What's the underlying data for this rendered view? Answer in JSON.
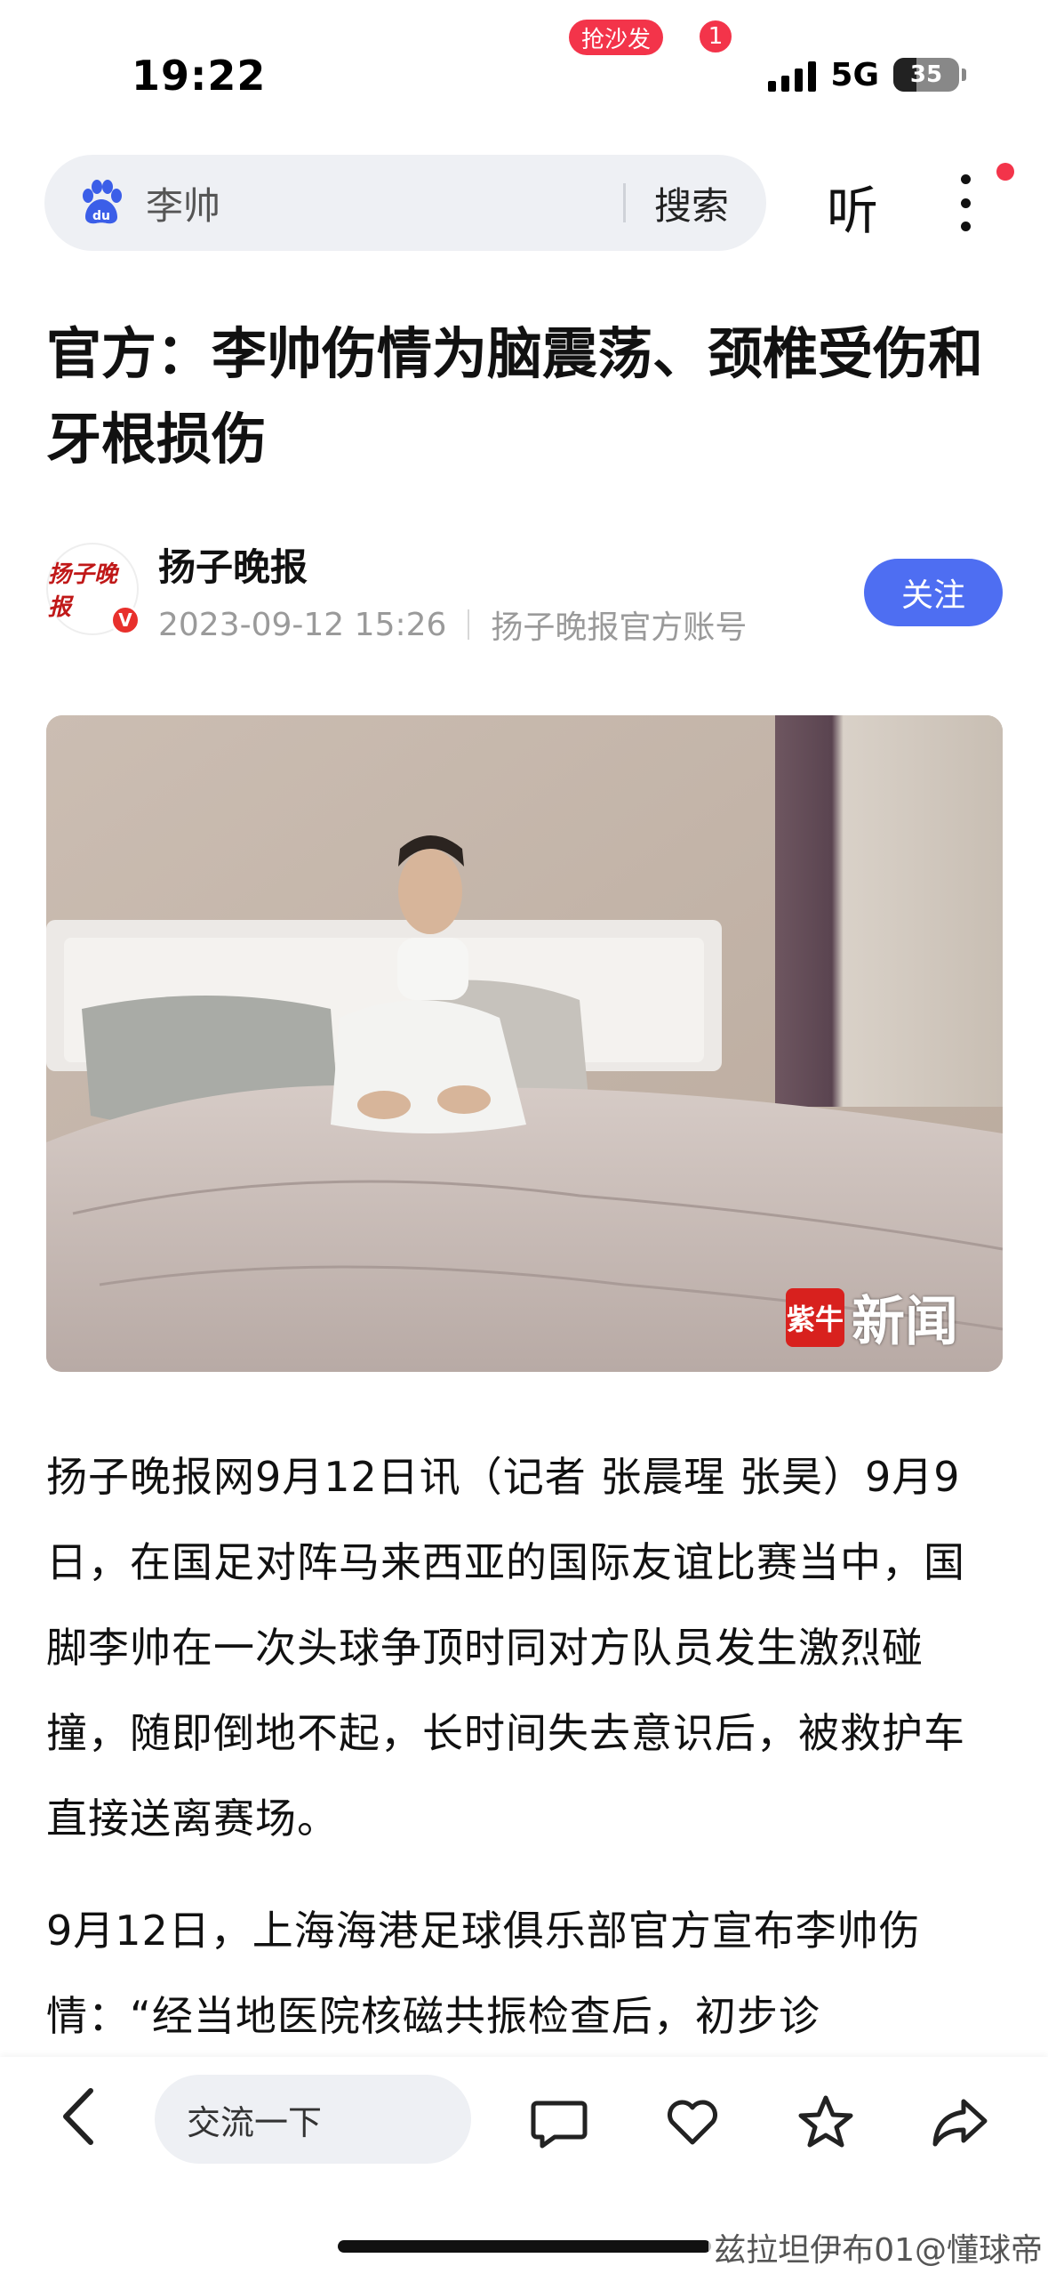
{
  "status_bar": {
    "time": "19:22",
    "network": "5G",
    "battery": "35",
    "battery_level": 0.35
  },
  "search": {
    "query": "李帅",
    "button": "搜索"
  },
  "header_actions": {
    "listen": "听"
  },
  "article": {
    "title": "官方：李帅伤情为脑震荡、颈椎受伤和牙根损伤",
    "author": {
      "name": "扬子晚报",
      "avatar_text": "扬子晚报",
      "verified_mark": "V",
      "date": "2023-09-12 15:26",
      "account_type": "扬子晚报官方账号"
    },
    "follow_label": "关注",
    "image_watermark": {
      "logo": "紫牛",
      "text": "新闻"
    },
    "paragraphs": [
      "扬子晚报网9月12日讯（记者 张晨瑆 张昊）9月9日，在国足对阵马来西亚的国际友谊比赛当中，国脚李帅在一次头球争顶时同对方队员发生激烈碰撞，随即倒地不起，长时间失去意识后，被救护车直接送离赛场。",
      "9月12日，上海海港足球俱乐部官方宣布李帅伤情：“经当地医院核磁共振检查后，初步诊"
    ]
  },
  "bottom_bar": {
    "comment_placeholder": "交流一下",
    "sofa_badge": "抢沙发",
    "like_count": "1"
  },
  "credit": "兹拉坦伊布01@懂球帝",
  "icons": [
    "baidu-paw-icon",
    "more-icon",
    "back-icon",
    "comment-icon",
    "like-icon",
    "star-icon",
    "share-icon"
  ]
}
